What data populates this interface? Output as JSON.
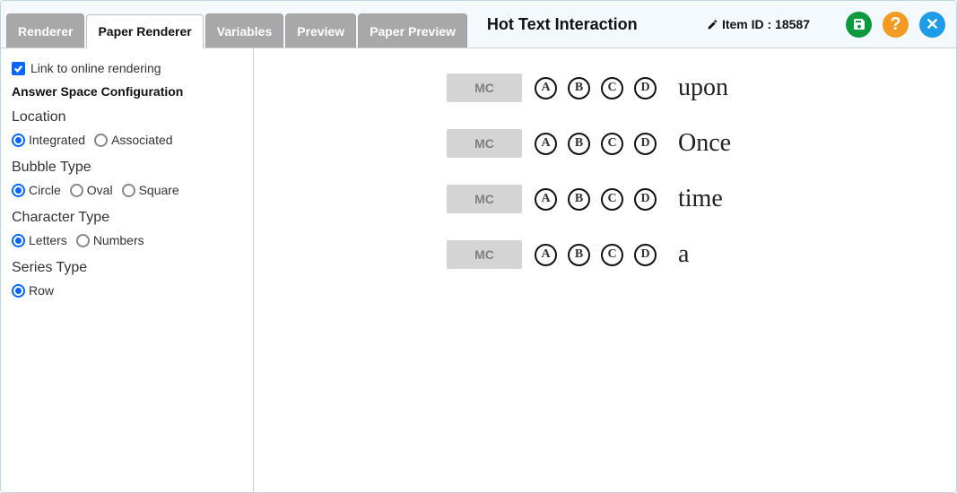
{
  "header": {
    "tabs": [
      {
        "label": "Renderer",
        "active": false
      },
      {
        "label": "Paper Renderer",
        "active": true
      },
      {
        "label": "Variables",
        "active": false
      },
      {
        "label": "Preview",
        "active": false
      },
      {
        "label": "Paper Preview",
        "active": false
      }
    ],
    "title": "Hot Text Interaction",
    "item_id_label": "Item ID : 18587"
  },
  "sidebar": {
    "link_online_label": "Link to online rendering",
    "link_online_checked": true,
    "config_title": "Answer Space Configuration",
    "location": {
      "label": "Location",
      "options": [
        "Integrated",
        "Associated"
      ],
      "selected": "Integrated"
    },
    "bubble_type": {
      "label": "Bubble Type",
      "options": [
        "Circle",
        "Oval",
        "Square"
      ],
      "selected": "Circle"
    },
    "character_type": {
      "label": "Character Type",
      "options": [
        "Letters",
        "Numbers"
      ],
      "selected": "Letters"
    },
    "series_type": {
      "label": "Series Type",
      "options": [
        "Row"
      ],
      "selected": "Row"
    }
  },
  "main": {
    "mc_label": "MC",
    "bubble_letters": [
      "A",
      "B",
      "C",
      "D"
    ],
    "rows": [
      {
        "text": "upon"
      },
      {
        "text": "Once"
      },
      {
        "text": "time"
      },
      {
        "text": "a"
      }
    ]
  }
}
